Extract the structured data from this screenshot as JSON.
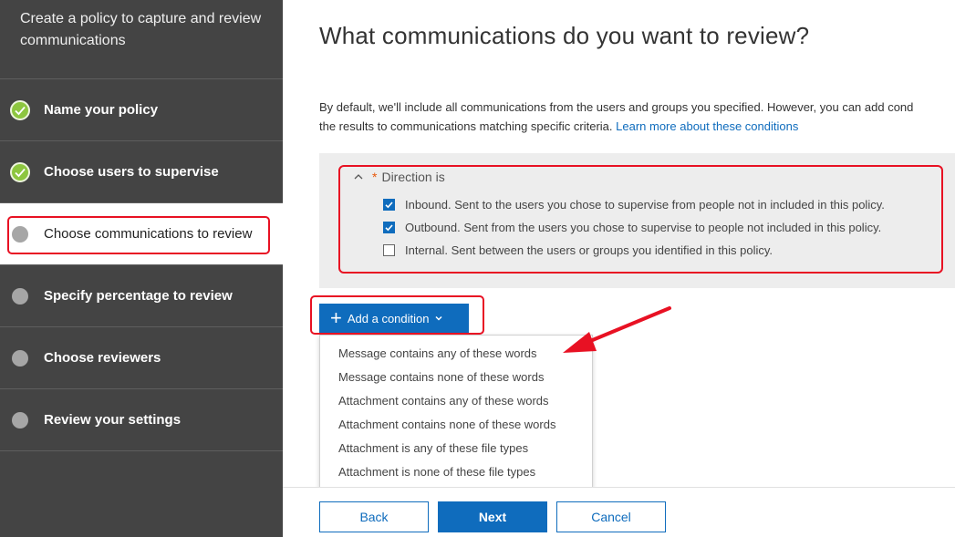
{
  "sidebar": {
    "header": "Create a policy to capture and review communications",
    "steps": [
      {
        "label": "Name your policy",
        "status": "done"
      },
      {
        "label": "Choose users to supervise",
        "status": "done"
      },
      {
        "label": "Choose communications to review",
        "status": "current"
      },
      {
        "label": "Specify percentage to review",
        "status": "pending"
      },
      {
        "label": "Choose reviewers",
        "status": "pending"
      },
      {
        "label": "Review your settings",
        "status": "pending"
      }
    ]
  },
  "main": {
    "title": "What communications do you want to review?",
    "intro_line1": "By default, we'll include all communications from the users and groups you specified. However, you can add cond",
    "intro_line2": "the results to communications matching specific criteria.",
    "learn_more": "Learn more about these conditions",
    "condition": {
      "required_mark": "*",
      "label": "Direction is",
      "options": [
        {
          "label": "Inbound. Sent to the users you chose to supervise from people not in included in this policy.",
          "checked": true
        },
        {
          "label": "Outbound. Sent from the users you chose to supervise to people not included in this policy.",
          "checked": true
        },
        {
          "label": "Internal. Sent between the users or groups you identified in this policy.",
          "checked": false
        }
      ]
    },
    "add_condition": {
      "plus": "+",
      "label": "Add a condition",
      "menu": [
        "Message contains any of these words",
        "Message contains none of these words",
        "Attachment contains any of these words",
        "Attachment contains none of these words",
        "Attachment is any of these file types",
        "Attachment is none of these file types"
      ]
    }
  },
  "footer": {
    "back": "Back",
    "next": "Next",
    "cancel": "Cancel"
  },
  "colors": {
    "sidebar_bg": "#444444",
    "accent": "#0f6cbd",
    "done_green": "#8dc63f",
    "annotation_red": "#e81123"
  }
}
